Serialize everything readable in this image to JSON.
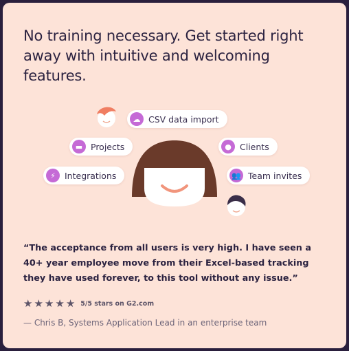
{
  "headline": "No training necessary. Get started right away with intuitive and welcoming features.",
  "features": [
    {
      "label": "CSV data import",
      "icon": "upload-cloud-icon"
    },
    {
      "label": "Projects",
      "icon": "folder-icon"
    },
    {
      "label": "Clients",
      "icon": "user-icon"
    },
    {
      "label": "Integrations",
      "icon": "plug-icon"
    },
    {
      "label": "Team invites",
      "icon": "users-icon"
    }
  ],
  "testimonial": {
    "quote": "“The acceptance from all users is very high. I have seen a 40+ year employee move from their Excel-based tracking they have used forever, to this tool without any issue.”",
    "rating_text": "5/5 stars on G2.com",
    "stars": 5,
    "author": "— Chris B, Systems Application Lead in an enterprise team"
  },
  "colors": {
    "card_bg": "#fde3d8",
    "accent": "#c56ad6",
    "text": "#2b2240",
    "hair_big": "#6a3a2a",
    "hair_small_red": "#f07e62",
    "hair_small_dark": "#3a2e48"
  }
}
